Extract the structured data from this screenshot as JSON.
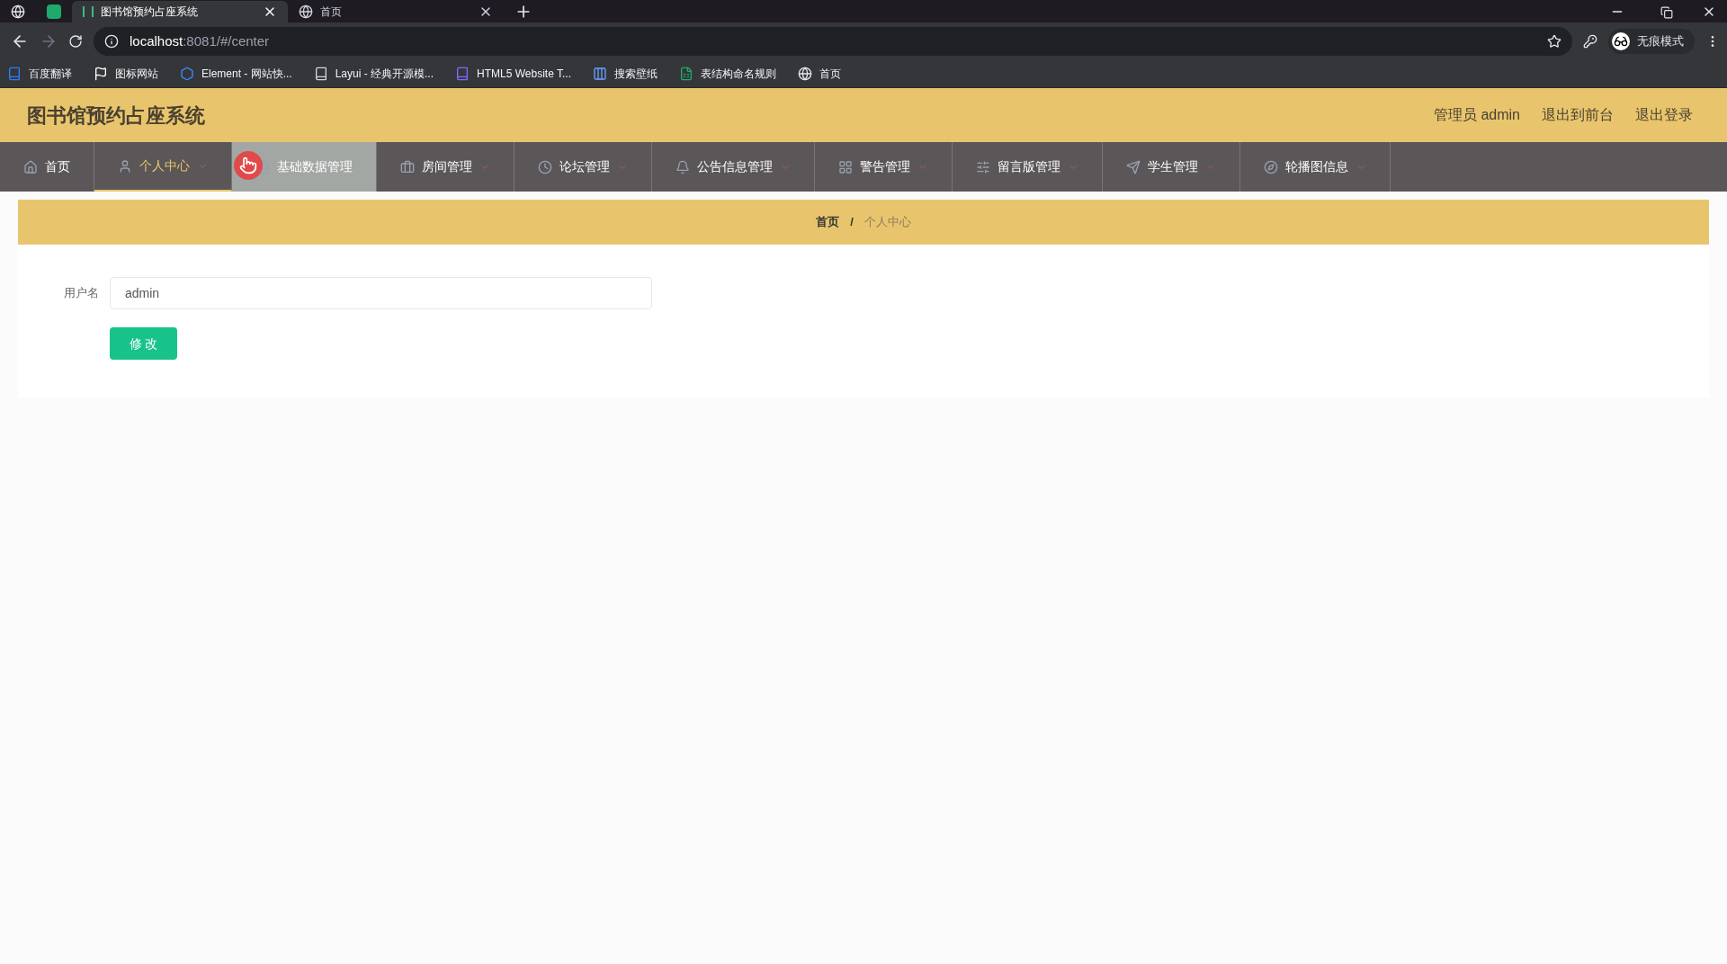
{
  "browser": {
    "tabs": [
      {
        "title": "图书馆预约占座系统",
        "selected": true
      },
      {
        "title": "首页",
        "selected": false
      }
    ],
    "address": {
      "host": "localhost",
      "rest": ":8081/#/center"
    },
    "profile": "无痕模式",
    "bookmarks": [
      "百度翻译",
      "图标网站",
      "Element - 网站快...",
      "Layui - 经典开源模...",
      "HTML5 Website T...",
      "搜索壁纸",
      "表结构命名规则",
      "首页"
    ]
  },
  "header": {
    "title": "图书馆预约占座系统",
    "links": [
      "管理员 admin",
      "退出到前台",
      "退出登录"
    ]
  },
  "nav": [
    {
      "label": "首页",
      "selected": false,
      "hovered": false,
      "dropdown": false
    },
    {
      "label": "个人中心",
      "selected": true,
      "hovered": false,
      "dropdown": true
    },
    {
      "label": "基础数据管理",
      "selected": false,
      "hovered": true,
      "dropdown": false
    },
    {
      "label": "房间管理",
      "selected": false,
      "hovered": false,
      "dropdown": true
    },
    {
      "label": "论坛管理",
      "selected": false,
      "hovered": false,
      "dropdown": true
    },
    {
      "label": "公告信息管理",
      "selected": false,
      "hovered": false,
      "dropdown": true
    },
    {
      "label": "警告管理",
      "selected": false,
      "hovered": false,
      "dropdown": true
    },
    {
      "label": "留言版管理",
      "selected": false,
      "hovered": false,
      "dropdown": true
    },
    {
      "label": "学生管理",
      "selected": false,
      "hovered": false,
      "dropdown": true
    },
    {
      "label": "轮播图信息",
      "selected": false,
      "hovered": false,
      "dropdown": true
    }
  ],
  "breadcrumb": {
    "items": [
      "首页",
      "个人中心"
    ],
    "separator": "/"
  },
  "form": {
    "fields": [
      {
        "label": "用户名",
        "value": "admin"
      }
    ],
    "submit": "修 改"
  }
}
